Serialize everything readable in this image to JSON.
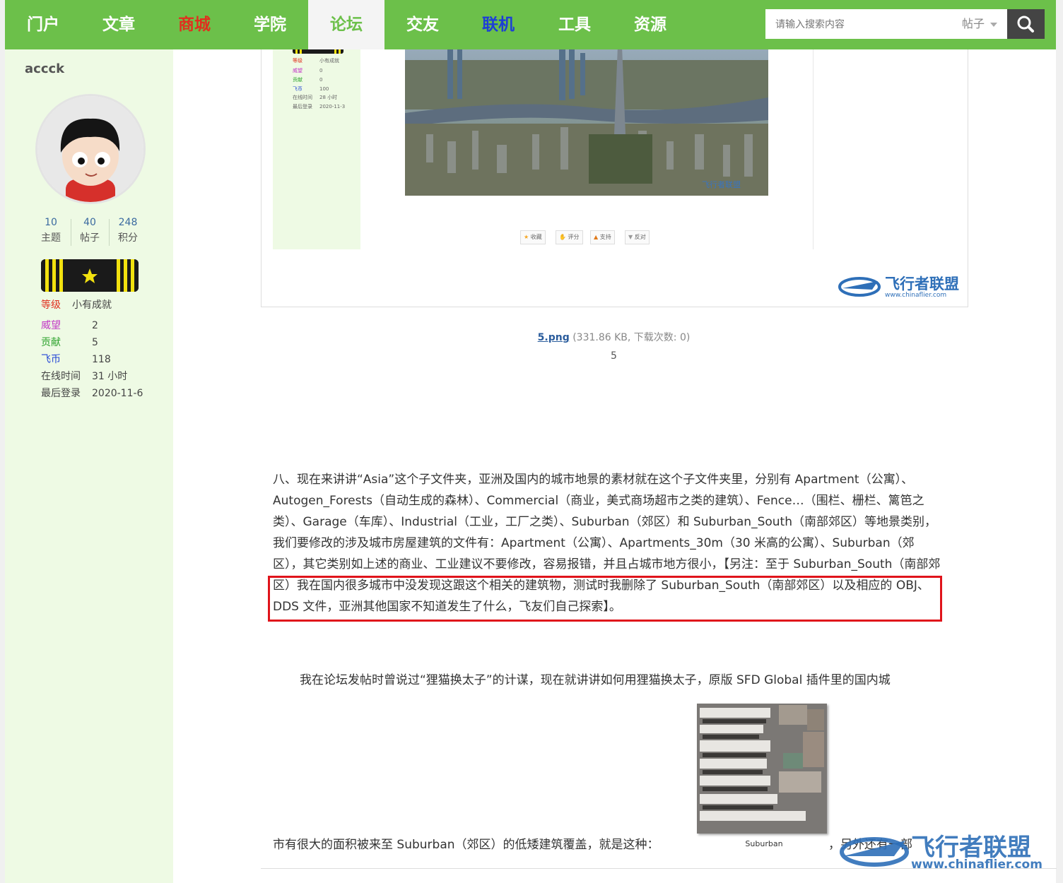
{
  "nav": {
    "items": [
      {
        "label": "门户",
        "color": "#ffffff"
      },
      {
        "label": "文章",
        "color": "#ffffff"
      },
      {
        "label": "商城",
        "color": "#e0301e"
      },
      {
        "label": "学院",
        "color": "#ffffff"
      },
      {
        "label": "论坛",
        "color": "#6cc04a"
      },
      {
        "label": "交友",
        "color": "#ffffff"
      },
      {
        "label": "联机",
        "color": "#1d3fd6"
      },
      {
        "label": "工具",
        "color": "#ffffff"
      },
      {
        "label": "资源",
        "color": "#ffffff"
      }
    ],
    "active_index": 4,
    "search_placeholder": "请输入搜索内容",
    "search_type": "帖子",
    "search_icon": "search-icon"
  },
  "profile": {
    "username": "accck",
    "stats": [
      {
        "value": "10",
        "label": "主题"
      },
      {
        "value": "40",
        "label": "帖子"
      },
      {
        "value": "248",
        "label": "积分"
      }
    ],
    "rank_badge_icon": "star-icon",
    "fields": [
      {
        "key": "等级",
        "value": "小有成就",
        "color": "#e0301e"
      },
      {
        "key": "威望",
        "value": "2",
        "color": "#c233c6"
      },
      {
        "key": "贡献",
        "value": "5",
        "color": "#2ea32e"
      },
      {
        "key": "飞币",
        "value": "118",
        "color": "#2447d6"
      },
      {
        "key": "在线时间",
        "value": "31 小时",
        "color": "#444444"
      },
      {
        "key": "最后登录",
        "value": "2020-11-6",
        "color": "#444444"
      }
    ]
  },
  "post_image": {
    "mini_profile": [
      {
        "key": "等级",
        "value": "小有成就"
      },
      {
        "key": "威望",
        "value": "0"
      },
      {
        "key": "贡献",
        "value": "0"
      },
      {
        "key": "飞币",
        "value": "100"
      },
      {
        "key": "在线时间",
        "value": "28 小时"
      },
      {
        "key": "最后登录",
        "value": "2020-11-3"
      }
    ],
    "buttons": [
      "收藏",
      "评分",
      "支持",
      "反对"
    ],
    "watermark_cn": "飞行者联盟",
    "watermark_url": "www.chinaflier.com"
  },
  "attachment": {
    "filename": "5.png",
    "meta": "(331.86 KB, 下载次数: 0)",
    "caption": "5"
  },
  "article": {
    "para8_before": "八、现在来讲讲“Asia”这个子文件夹，亚洲及国内的城市地景的素材就在这个子文件夹里，分别有 Apartment（公寓）、 Autogen_Forests（自动生成的森林）、Commercial（商业，美式商场超市之类的建筑）、Fence…（围栏、栅栏、篱笆之类）、Garage（车库）、Industrial（工业，工厂之类）、Suburban（郊区）和 Suburban_South（南部郊区）等地景类别，我们要修改的涉及城市房屋建筑的文件有：Apartment（公寓）、Apartments_30m（30 米高的公寓）、Suburban（郊区），其它类别如上述的商业、工业建议不要修改，容易报错，并且占城市地方很小，【另注：",
    "para8_highlight": "至于 Suburban_South（南部郊区）我在国内很多城市中没发现这跟这个相关的建筑物，测试时我删除了 Suburban_South（南部郊区）以及相应的 OBJ、DDS 文件，亚洲其他国家不知道发生了什么，飞友们自己探索】。",
    "para9": "我在论坛发帖时曾说过“狸猫换太子”的计谋，现在就讲讲如何用狸猫换太子，原版 SFD Global 插件里的国内城",
    "para10": "市有很大的面积被来至 Suburban（郊区）的低矮建筑覆盖，就是这种：",
    "texture_caption": "Suburban",
    "para10_after": "，另外还有一部",
    "watermark_cn": "飞行者联盟",
    "watermark_url": "www.chinaflier.com"
  }
}
